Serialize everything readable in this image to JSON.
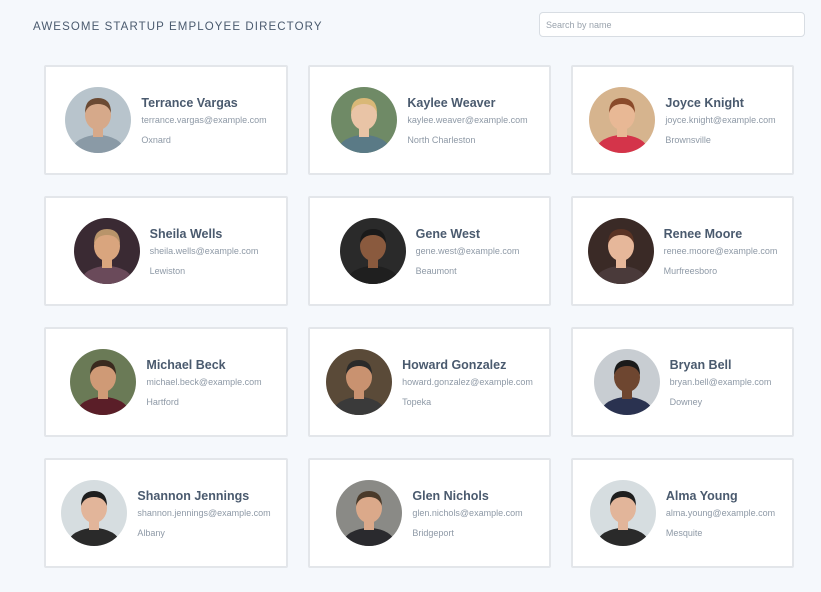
{
  "header": {
    "title": "AWESOME STARTUP EMPLOYEE DIRECTORY",
    "search_placeholder": "Search by name"
  },
  "employees": [
    {
      "name": "Terrance Vargas",
      "email": "terrance.vargas@example.com",
      "city": "Oxnard",
      "bg": "#b8c4cc",
      "skin": "#d6a98a",
      "hair": "#6b4a33",
      "shirt": "#8a9aa6"
    },
    {
      "name": "Kaylee Weaver",
      "email": "kaylee.weaver@example.com",
      "city": "North Charleston",
      "bg": "#6f8a66",
      "skin": "#e9c4a6",
      "hair": "#d9b877",
      "shirt": "#5a7a86"
    },
    {
      "name": "Joyce Knight",
      "email": "joyce.knight@example.com",
      "city": "Brownsville",
      "bg": "#d6b48e",
      "skin": "#e8b895",
      "hair": "#8a4a2a",
      "shirt": "#d4344a"
    },
    {
      "name": "Sheila Wells",
      "email": "sheila.wells@example.com",
      "city": "Lewiston",
      "bg": "#3a2a33",
      "skin": "#d9a57e",
      "hair": "#b8946a",
      "shirt": "#6a4a5a"
    },
    {
      "name": "Gene West",
      "email": "gene.west@example.com",
      "city": "Beaumont",
      "bg": "#2a2a2a",
      "skin": "#8a5a3e",
      "hair": "#1a1a1a",
      "shirt": "#1f1f1f"
    },
    {
      "name": "Renee Moore",
      "email": "renee.moore@example.com",
      "city": "Murfreesboro",
      "bg": "#3a2a26",
      "skin": "#e6b79a",
      "hair": "#5a3324",
      "shirt": "#4a3a3a"
    },
    {
      "name": "Michael Beck",
      "email": "michael.beck@example.com",
      "city": "Hartford",
      "bg": "#6a7a56",
      "skin": "#cf9a76",
      "hair": "#3a2a1e",
      "shirt": "#5a1e28"
    },
    {
      "name": "Howard Gonzalez",
      "email": "howard.gonzalez@example.com",
      "city": "Topeka",
      "bg": "#5a4a38",
      "skin": "#c99270",
      "hair": "#2a2a2a",
      "shirt": "#3a3a3a"
    },
    {
      "name": "Bryan Bell",
      "email": "bryan.bell@example.com",
      "city": "Downey",
      "bg": "#c8cdd2",
      "skin": "#6e4630",
      "hair": "#1a1a1a",
      "shirt": "#2a3250"
    },
    {
      "name": "Shannon Jennings",
      "email": "shannon.jennings@example.com",
      "city": "Albany",
      "bg": "#d6dde0",
      "skin": "#e2b59a",
      "hair": "#1e1e1e",
      "shirt": "#2a2a2a"
    },
    {
      "name": "Glen Nichols",
      "email": "glen.nichols@example.com",
      "city": "Bridgeport",
      "bg": "#8a8a86",
      "skin": "#dba98a",
      "hair": "#4a3a2a",
      "shirt": "#2a2a2e"
    },
    {
      "name": "Alma Young",
      "email": "alma.young@example.com",
      "city": "Mesquite",
      "bg": "#d6dde0",
      "skin": "#e2b59a",
      "hair": "#1e1e1e",
      "shirt": "#2a2a2a"
    }
  ]
}
